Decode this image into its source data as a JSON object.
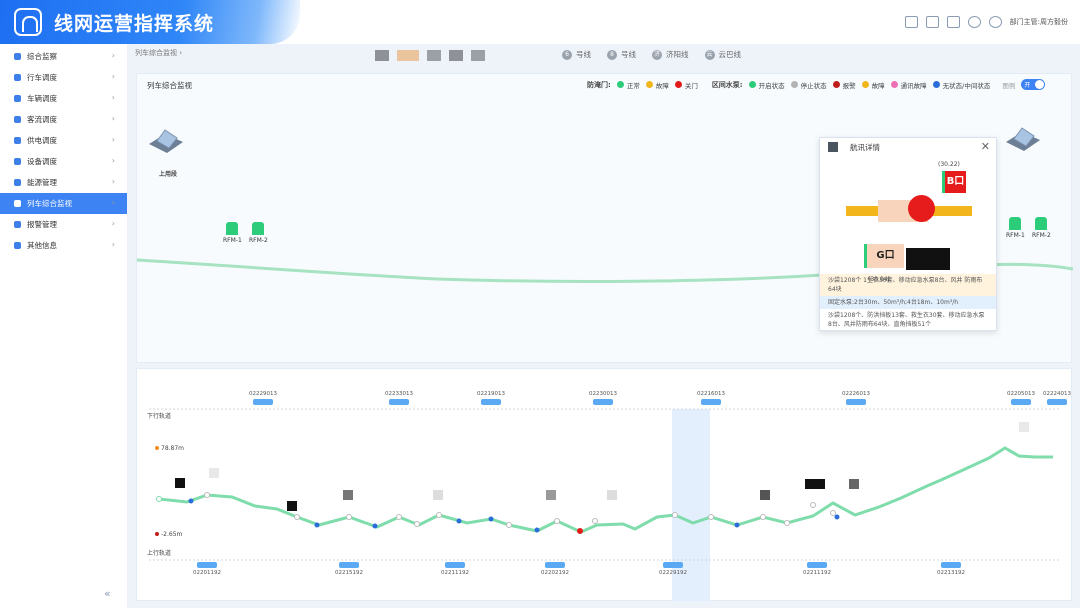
{
  "header": {
    "title": "线网运营指挥系统",
    "user": "部门主管:周方毅份"
  },
  "sidebar": {
    "items": [
      {
        "label": "综合监察"
      },
      {
        "label": "行车调度"
      },
      {
        "label": "车辆调度"
      },
      {
        "label": "客流调度"
      },
      {
        "label": "供电调度"
      },
      {
        "label": "设备调度"
      },
      {
        "label": "能源管理"
      },
      {
        "label": "列车综合监视",
        "active": true
      },
      {
        "label": "报警管理"
      },
      {
        "label": "其他信息"
      }
    ]
  },
  "breadcrumb": "列车综合监视 ›",
  "lines": [
    {
      "label": "号线",
      "icon": "6"
    },
    {
      "label": "号线",
      "icon": "8"
    },
    {
      "label": "济阳线",
      "icon": "济"
    },
    {
      "label": "云巴线",
      "icon": "云"
    }
  ],
  "panel": {
    "title": "列车综合监视",
    "legend": {
      "door_label": "防淹门:",
      "normal": "正常",
      "fault": "故障",
      "closed": "关门",
      "pump_label": "区间水泵:",
      "open": "开启状态",
      "stop": "停止状态",
      "alarm": "报警",
      "pfault": "故障",
      "comm": "通讯故障",
      "nostate": "无状态/中间状态",
      "switch_label": "图例",
      "switch_value": "开"
    },
    "station_left": "上用段",
    "rfm": [
      "RFM-1",
      "RFM-2"
    ]
  },
  "popup": {
    "title": "航讯详情",
    "coord_top": "(30.22)",
    "coord_bottom": "(30.04)",
    "gate_b": "B口",
    "gate_g": "G口",
    "row1": "沙袋1208个    1生衣30套、移动应急水泵8台、风井    防雨布64块",
    "row2": "固定水泵:2台30m、50m³/h;4台18m、10m³/h",
    "row3": "沙袋1208个、防洪挡板13套、救生衣30套、移动应急水泵8台、风井防雨布64块、直角挡板51个"
  },
  "track": {
    "down_label": "下行轨道",
    "up_label": "上行轨道",
    "max_label": "78.87m",
    "min_label": "-2.65m",
    "top_trains": [
      "02229013",
      "02233013",
      "02219013",
      "02230013",
      "02216013",
      "02226013",
      "02205013",
      "02224013"
    ],
    "bottom_trains": [
      "02201192",
      "02215192",
      "02211192",
      "02202192",
      "02229192",
      "02211192",
      "02213192"
    ]
  },
  "colors": {
    "accent": "#3d83f3",
    "green": "#2dcc7a",
    "red": "#e21b1b"
  }
}
